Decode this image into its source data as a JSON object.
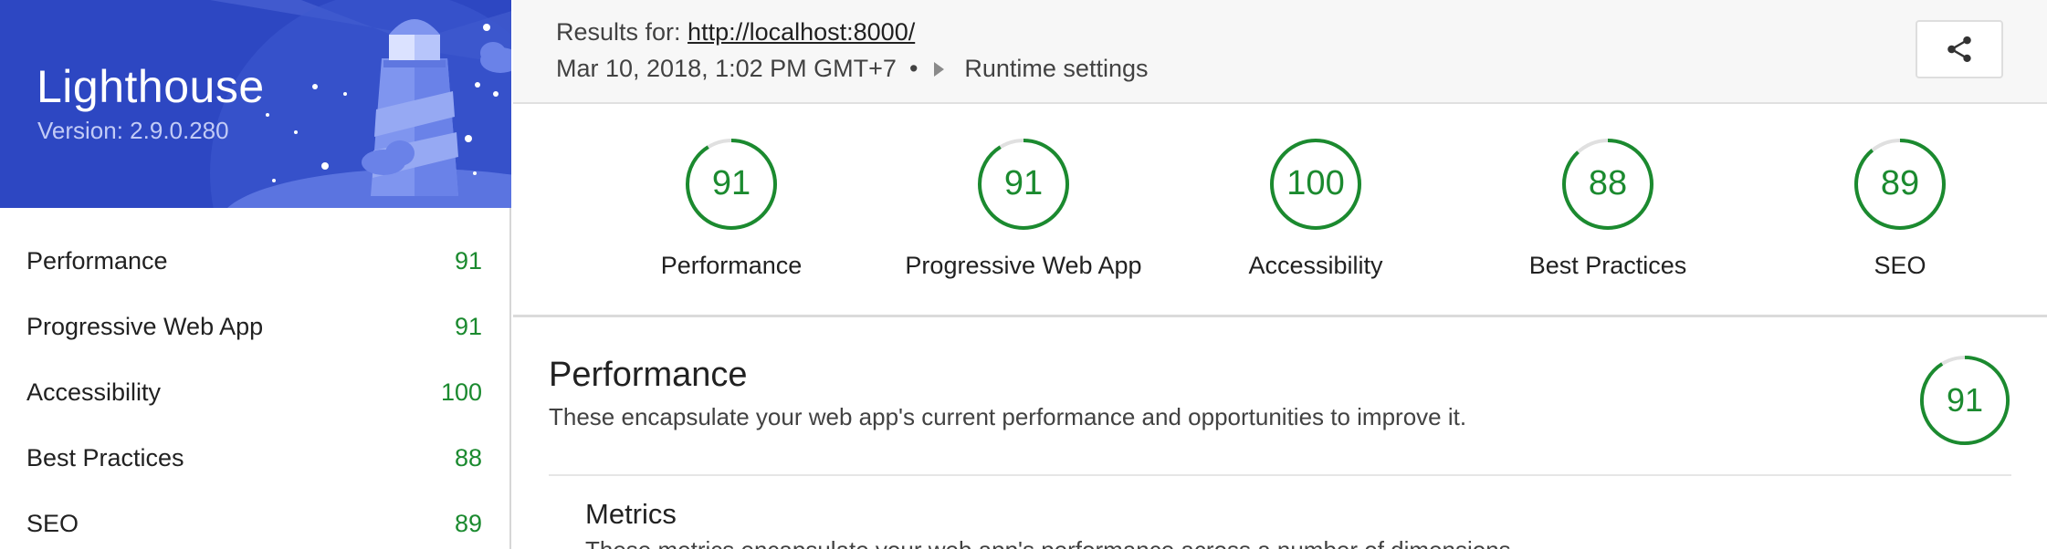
{
  "app": {
    "name": "Lighthouse",
    "version": "Version: 2.9.0.280"
  },
  "sidebar": {
    "items": [
      {
        "label": "Performance",
        "score": "91"
      },
      {
        "label": "Progressive Web App",
        "score": "91"
      },
      {
        "label": "Accessibility",
        "score": "100"
      },
      {
        "label": "Best Practices",
        "score": "88"
      },
      {
        "label": "SEO",
        "score": "89"
      }
    ]
  },
  "header": {
    "results_prefix": "Results for: ",
    "url": "http://localhost:8000/",
    "timestamp": "Mar 10, 2018, 1:02 PM GMT+7",
    "separator": "•",
    "runtime_settings_label": "Runtime settings",
    "share_icon": "share-icon"
  },
  "gauges": [
    {
      "label": "Performance",
      "value": "91",
      "fraction": 0.91
    },
    {
      "label": "Progressive Web App",
      "value": "91",
      "fraction": 0.91
    },
    {
      "label": "Accessibility",
      "value": "100",
      "fraction": 1.0
    },
    {
      "label": "Best Practices",
      "value": "88",
      "fraction": 0.88
    },
    {
      "label": "SEO",
      "value": "89",
      "fraction": 0.89
    }
  ],
  "section": {
    "title": "Performance",
    "description": "These encapsulate your web app's current performance and opportunities to improve it.",
    "score": "91",
    "fraction": 0.91,
    "metrics_title": "Metrics",
    "metrics_description": "These metrics encapsulate your web app's performance across a number of dimensions."
  },
  "colors": {
    "pass": "#1b8a2f",
    "banner": "#2d47c2",
    "gauge_track": "#e0e0e0"
  }
}
